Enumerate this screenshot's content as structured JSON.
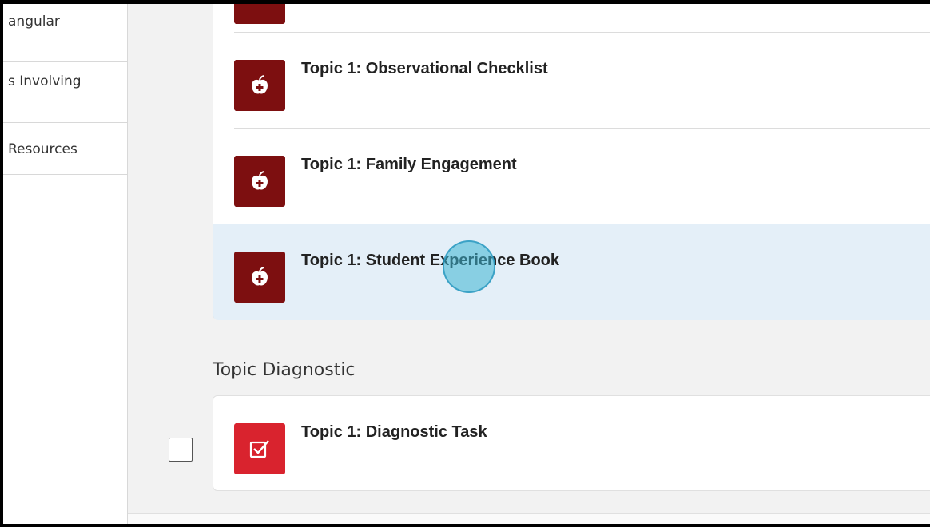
{
  "sidebar": {
    "items": [
      {
        "label": "angular"
      },
      {
        "label": "s Involving"
      },
      {
        "label": "Resources"
      }
    ]
  },
  "resources": {
    "items": [
      {
        "title": "Topic 1: Observational Checklist",
        "icon": "apple-icon"
      },
      {
        "title": "Topic 1: Family Engagement",
        "icon": "apple-icon"
      },
      {
        "title": "Topic 1: Student Experience Book",
        "icon": "apple-icon"
      }
    ]
  },
  "diagnostic": {
    "section_title": "Topic Diagnostic",
    "items": [
      {
        "title": "Topic 1: Diagnostic Task",
        "icon": "checkbox-icon"
      }
    ]
  },
  "colors": {
    "apple_icon_bg": "#7d0f10",
    "check_icon_bg": "#d9232e",
    "active_row_bg": "#e4eff8",
    "click_indicator": "#3cb4d2"
  }
}
